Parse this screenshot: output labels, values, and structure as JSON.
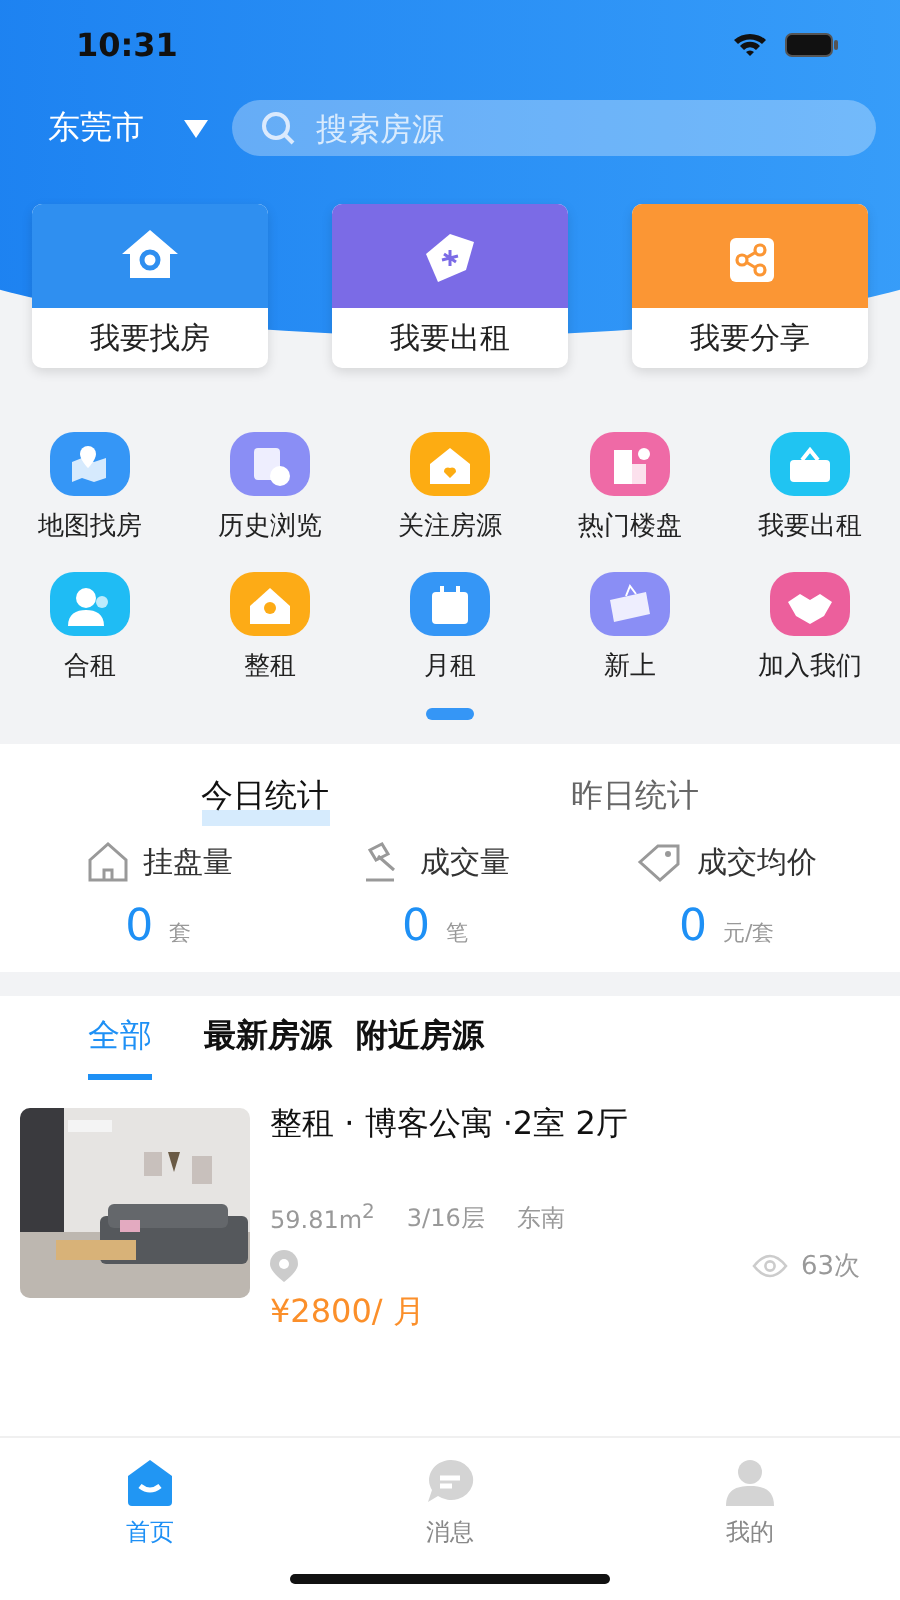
{
  "status_bar": {
    "time": "10:31"
  },
  "header": {
    "city": "东莞市",
    "search": {
      "placeholder": "搜索房源"
    }
  },
  "action_cards": [
    {
      "label": "我要找房",
      "color": "#2f8ff0"
    },
    {
      "label": "我要出租",
      "color": "#7b6be6"
    },
    {
      "label": "我要分享",
      "color": "#fb9634"
    }
  ],
  "shortcuts": [
    {
      "label": "地图找房",
      "color": "#3596f6"
    },
    {
      "label": "历史浏览",
      "color": "#8a8ef5"
    },
    {
      "label": "关注房源",
      "color": "#fdac12"
    },
    {
      "label": "热门楼盘",
      "color": "#ef6aa6"
    },
    {
      "label": "我要出租",
      "color": "#20c4f2"
    },
    {
      "label": "合租",
      "color": "#1fbcf4"
    },
    {
      "label": "整租",
      "color": "#fdab16"
    },
    {
      "label": "月租",
      "color": "#3596f6"
    },
    {
      "label": "新上",
      "color": "#8a8ef5"
    },
    {
      "label": "加入我们",
      "color": "#ec5f9c"
    }
  ],
  "stats": {
    "tabs": [
      {
        "label": "今日统计",
        "selected": true
      },
      {
        "label": "昨日统计",
        "selected": false
      }
    ],
    "items": [
      {
        "label": "挂盘量",
        "value": "0",
        "unit": "套"
      },
      {
        "label": "成交量",
        "value": "0",
        "unit": "笔"
      },
      {
        "label": "成交均价",
        "value": "0",
        "unit": "元/套"
      }
    ]
  },
  "listing_tabs": [
    {
      "label": "全部",
      "selected": true
    },
    {
      "label": "最新房源",
      "selected": false
    },
    {
      "label": "附近房源",
      "selected": false
    }
  ],
  "listings": [
    {
      "kind": "picture",
      "title": "整租 · 博客公寓 ·2室 2厅",
      "area": "59.81m$^{2}$",
      "floor": "3/16层",
      "orientation": "东南",
      "views": "63次",
      "price": "¥2800/ 月"
    }
  ],
  "bottom_nav": [
    {
      "label": "首页",
      "selected": true
    },
    {
      "label": "消息",
      "selected": false
    },
    {
      "label": "我的",
      "selected": false
    }
  ]
}
